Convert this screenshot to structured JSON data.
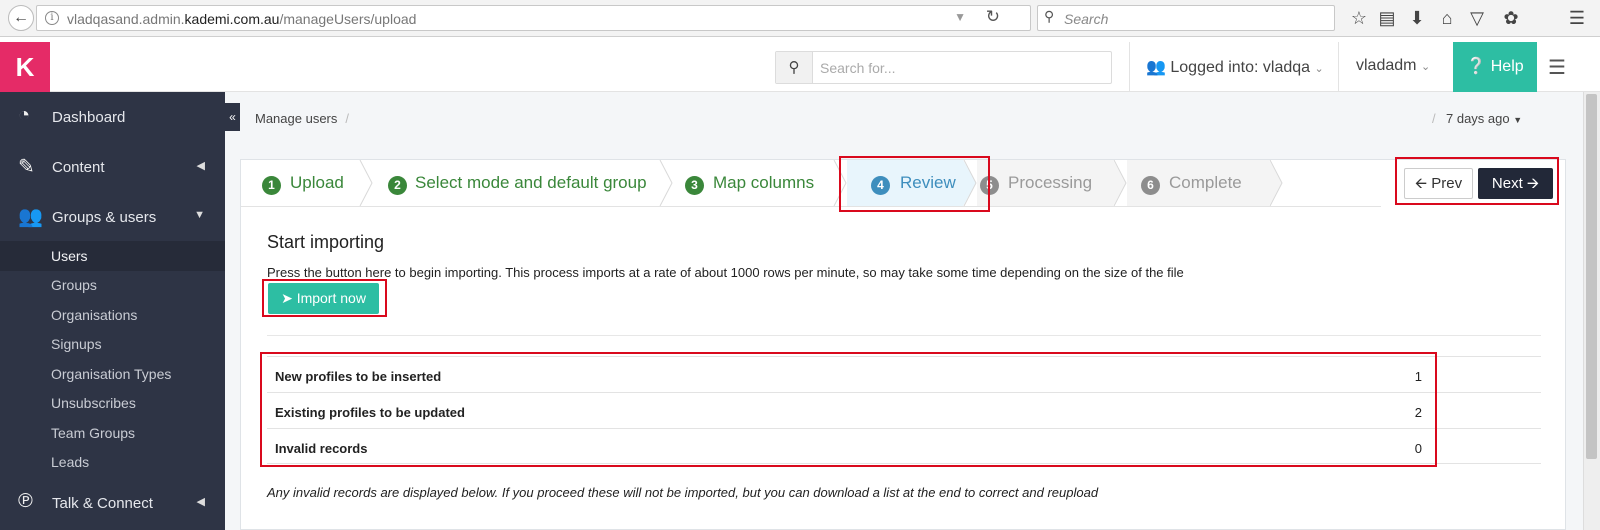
{
  "browser": {
    "url_prefix": "vladqasand.admin.",
    "url_domain": "kademi.com.au",
    "url_path": "/manageUsers/upload",
    "search_placeholder": "Search"
  },
  "header": {
    "logo": "K",
    "search_placeholder": "Search for...",
    "logged_into": "Logged into: vladqa",
    "user": "vladadm",
    "help": "Help"
  },
  "sidebar": {
    "items": [
      {
        "label": "Dashboard"
      },
      {
        "label": "Content"
      },
      {
        "label": "Groups & users"
      },
      {
        "label": "Talk & Connect"
      }
    ],
    "sub_items": [
      {
        "label": "Users"
      },
      {
        "label": "Groups"
      },
      {
        "label": "Organisations"
      },
      {
        "label": "Signups"
      },
      {
        "label": "Organisation Types"
      },
      {
        "label": "Unsubscribes"
      },
      {
        "label": "Team Groups"
      },
      {
        "label": "Leads"
      }
    ]
  },
  "breadcrumb": {
    "item": "Manage users",
    "sep": "/"
  },
  "time_filter": "7 days ago",
  "wizard": {
    "steps": [
      {
        "num": "1",
        "label": "Upload",
        "state": "done"
      },
      {
        "num": "2",
        "label": "Select mode and default group",
        "state": "done"
      },
      {
        "num": "3",
        "label": "Map columns",
        "state": "done"
      },
      {
        "num": "4",
        "label": "Review",
        "state": "current"
      },
      {
        "num": "5",
        "label": "Processing",
        "state": "todo"
      },
      {
        "num": "6",
        "label": "Complete",
        "state": "todo"
      }
    ],
    "prev": "Prev",
    "next": "Next"
  },
  "main": {
    "title": "Start importing",
    "description": "Press the button here to begin importing. This process imports at a rate of about 1000 rows per minute, so may take some time depending on the size of the file",
    "import_button": "Import now",
    "summary": [
      {
        "label": "New profiles to be inserted",
        "value": "1"
      },
      {
        "label": "Existing profiles to be updated",
        "value": "2"
      },
      {
        "label": "Invalid records",
        "value": "0"
      }
    ],
    "note": "Any invalid records are displayed below. If you proceed these will not be imported, but you can download a list at the end to correct and reupload"
  },
  "colors": {
    "brand": "#e52b67",
    "accent": "#2dbea3",
    "sidebar": "#2e3445",
    "step_done": "#3a873a",
    "step_current": "#3e8ebd",
    "highlight": "#d9091d"
  }
}
